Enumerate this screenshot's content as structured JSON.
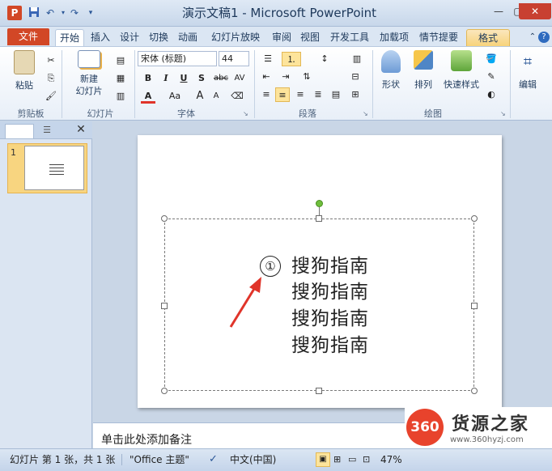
{
  "window": {
    "title": "演示文稿1 - Microsoft PowerPoint",
    "minimize_icon": "minimize-icon",
    "maximize_icon": "maximize-icon",
    "close_icon": "close-icon"
  },
  "quick_access": {
    "app_icon_letter": "P",
    "save_icon": "save-icon",
    "undo_icon": "undo-icon",
    "redo_icon": "redo-icon"
  },
  "tabs": {
    "file": "文件",
    "items": [
      "开始",
      "插入",
      "设计",
      "切换",
      "动画",
      "幻灯片放映",
      "审阅",
      "视图",
      "开发工具",
      "加载项",
      "情节提要"
    ],
    "format": "格式",
    "collapse_icon": "chevron-up-icon",
    "help_icon": "help-icon"
  },
  "ribbon": {
    "clipboard": {
      "paste": "粘贴",
      "group": "剪贴板"
    },
    "slides": {
      "new_slide": "新建\n幻灯片",
      "group": "幻灯片"
    },
    "font": {
      "font_name": "宋体 (标题)",
      "font_size": "44",
      "bold": "B",
      "italic": "I",
      "underline": "U",
      "shadow": "S",
      "strike": "abc",
      "spacing": "AV",
      "color": "A",
      "case": "Aa",
      "grow": "A",
      "shrink": "A",
      "group": "字体"
    },
    "paragraph": {
      "group": "段落"
    },
    "drawing": {
      "shapes": "形状",
      "arrange": "排列",
      "quick_styles": "快速样式",
      "group": "绘图"
    },
    "editing": {
      "label": "编辑"
    }
  },
  "slides_pane": {
    "slide_number": "1",
    "close_icon": "close-icon"
  },
  "slide": {
    "bullet": "①",
    "lines": [
      "搜狗指南",
      "搜狗指南",
      "搜狗指南",
      "搜狗指南"
    ]
  },
  "notes": {
    "placeholder": "单击此处添加备注"
  },
  "status": {
    "slide_info": "幻灯片 第 1 张，共 1 张",
    "theme": "\"Office 主题\"",
    "language": "中文(中国)",
    "zoom": "47%"
  },
  "watermark": {
    "logo_text": "360",
    "name": "货源之家",
    "url": "www.360hyzj.com"
  },
  "colors": {
    "file_tab": "#d24726",
    "accent": "#f7d37a",
    "arrow": "#e0342a"
  }
}
